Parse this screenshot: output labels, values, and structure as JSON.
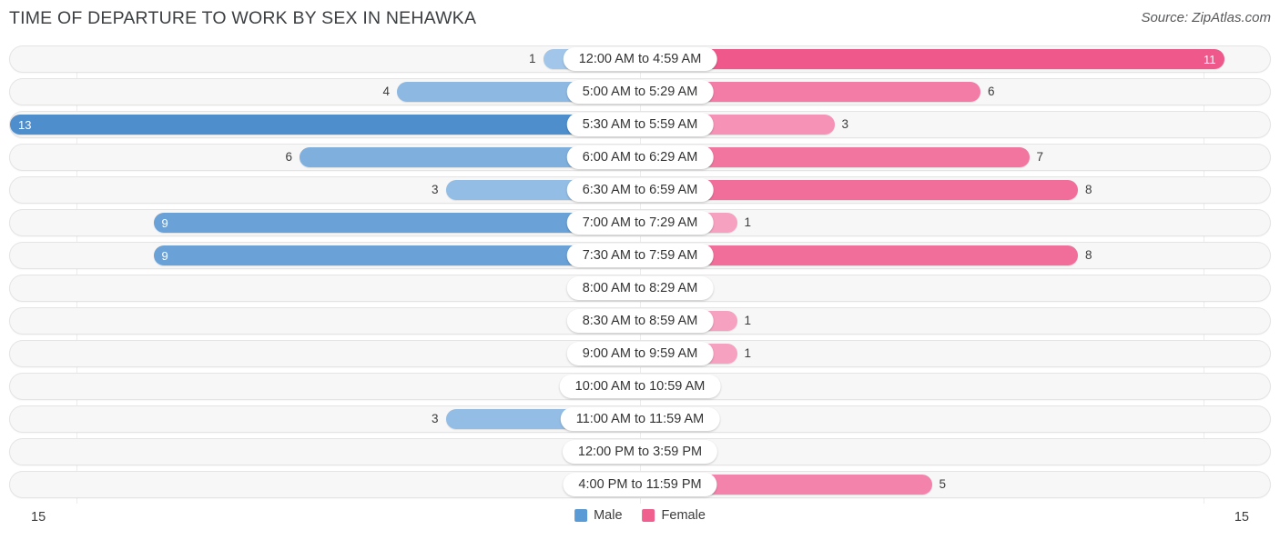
{
  "header": {
    "title": "TIME OF DEPARTURE TO WORK BY SEX IN NEHAWKA",
    "source": "Source: ZipAtlas.com"
  },
  "axis": {
    "left_label": "15",
    "right_label": "15"
  },
  "legend": {
    "items": [
      {
        "label": "Male",
        "color": "#5b9bd5"
      },
      {
        "label": "Female",
        "color": "#f0608f"
      }
    ]
  },
  "chart_data": {
    "type": "bar",
    "subtype": "diverging-horizontal-bar",
    "title": "TIME OF DEPARTURE TO WORK BY SEX IN NEHAWKA",
    "source": "Source: ZipAtlas.com",
    "xlabel": "",
    "ylabel": "",
    "xlim": [
      15,
      15
    ],
    "axis_max": 15,
    "grid": false,
    "legend_position": "bottom-center",
    "categories": [
      "12:00 AM to 4:59 AM",
      "5:00 AM to 5:29 AM",
      "5:30 AM to 5:59 AM",
      "6:00 AM to 6:29 AM",
      "6:30 AM to 6:59 AM",
      "7:00 AM to 7:29 AM",
      "7:30 AM to 7:59 AM",
      "8:00 AM to 8:29 AM",
      "8:30 AM to 8:59 AM",
      "9:00 AM to 9:59 AM",
      "10:00 AM to 10:59 AM",
      "11:00 AM to 11:59 AM",
      "12:00 PM to 3:59 PM",
      "4:00 PM to 11:59 PM"
    ],
    "series": [
      {
        "name": "Male",
        "color": "#5b9bd5",
        "direction": "left",
        "values": [
          1,
          4,
          13,
          6,
          3,
          9,
          9,
          0,
          0,
          0,
          0,
          3,
          0,
          0
        ]
      },
      {
        "name": "Female",
        "color": "#f0608f",
        "direction": "right",
        "values": [
          11,
          6,
          3,
          7,
          8,
          1,
          8,
          0,
          1,
          1,
          0,
          0,
          0,
          5
        ]
      }
    ]
  }
}
